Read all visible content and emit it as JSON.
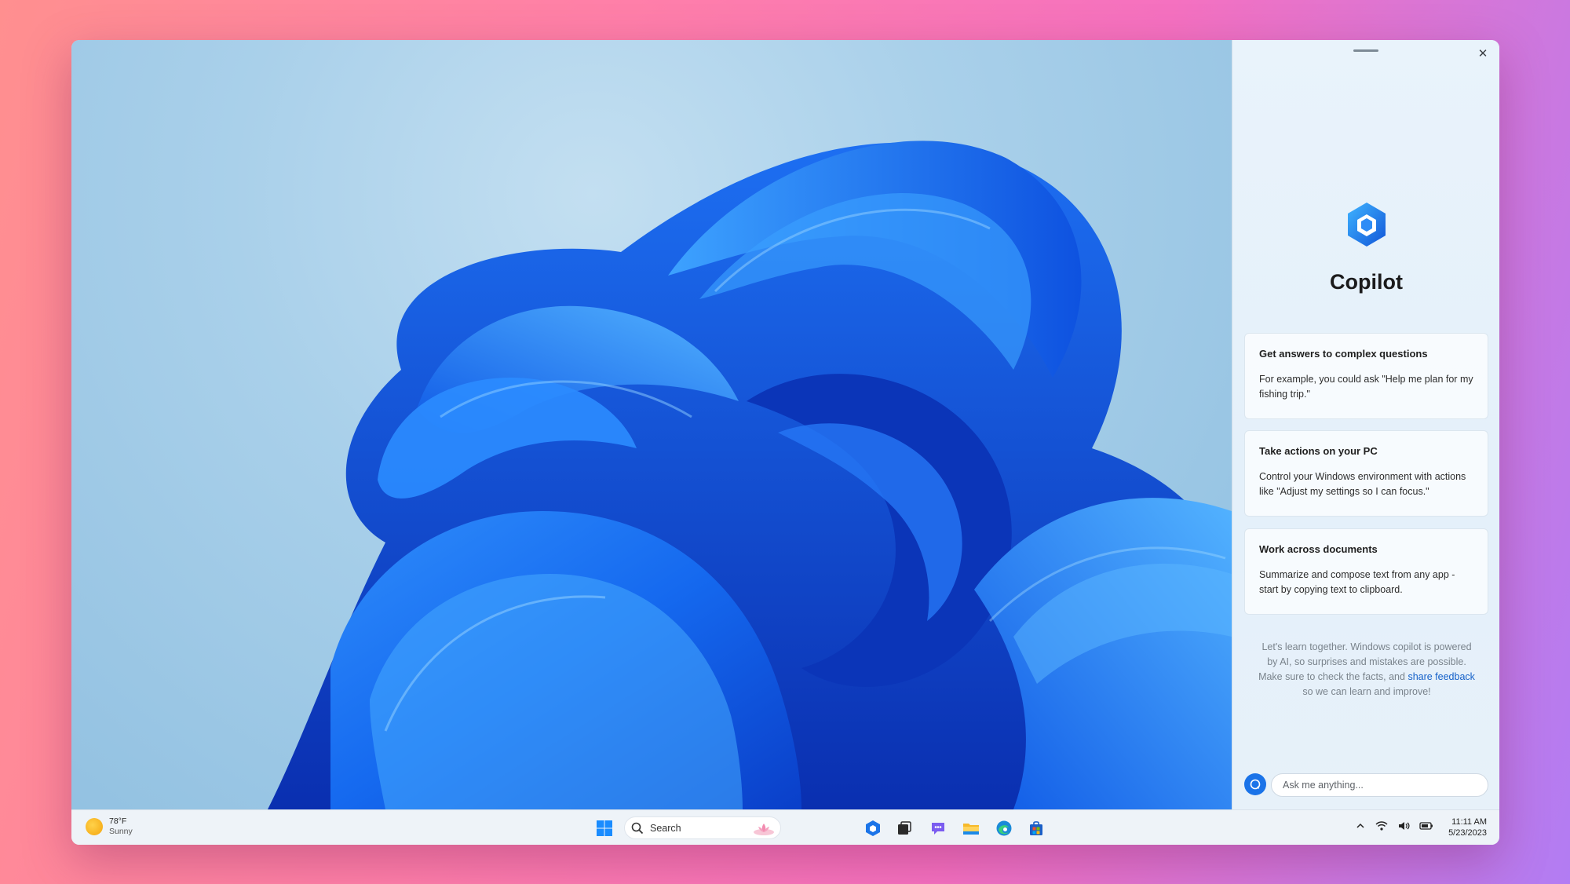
{
  "copilot": {
    "title": "Copilot",
    "close_glyph": "✕",
    "cards": [
      {
        "title": "Get answers to complex questions",
        "body": "For example, you could ask \"Help me plan for my fishing trip.\""
      },
      {
        "title": "Take actions on your PC",
        "body": "Control your Windows environment with actions like \"Adjust my settings so I can focus.\""
      },
      {
        "title": "Work across documents",
        "body": "Summarize and compose text from any app - start by copying text to clipboard."
      }
    ],
    "disclaimer_before": "Let's learn together. Windows copilot is powered by AI, so surprises and mistakes are possible. Make sure to check the facts, and ",
    "disclaimer_link": "share feedback",
    "disclaimer_after": " so we can learn and improve!",
    "input_placeholder": "Ask me anything...",
    "accent_color": "#1a73e8"
  },
  "taskbar": {
    "weather_temp": "78°F",
    "weather_condition": "Sunny",
    "search_label": "Search",
    "clock_time": "11:11 AM",
    "clock_date": "5/23/2023",
    "apps": [
      "copilot-icon",
      "task-view-icon",
      "teams-chat-icon",
      "file-explorer-icon",
      "edge-icon",
      "store-icon"
    ],
    "tray_icons": [
      "chevron-up-icon",
      "wifi-icon",
      "volume-icon",
      "battery-icon"
    ]
  }
}
